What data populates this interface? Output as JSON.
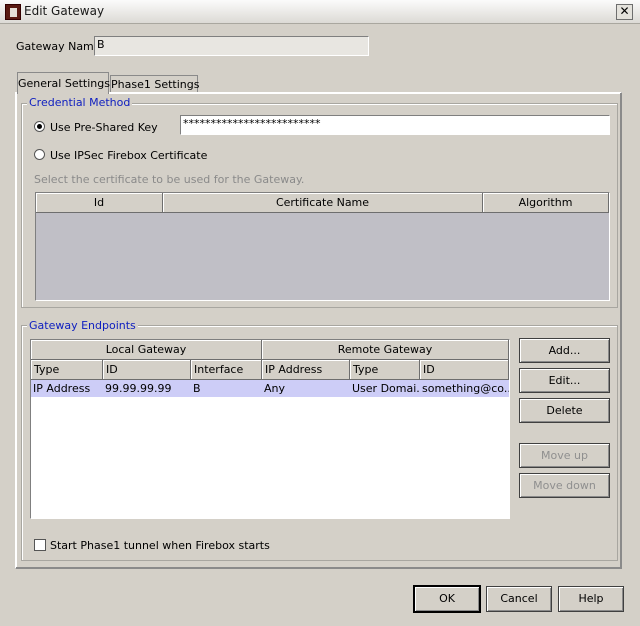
{
  "window": {
    "title": "Edit Gateway",
    "close_glyph": "✕"
  },
  "gateway_name": {
    "label": "Gateway Name:",
    "value": "B"
  },
  "tabs": [
    {
      "label": "General Settings",
      "active": true
    },
    {
      "label": "Phase1 Settings",
      "active": false
    }
  ],
  "credential": {
    "title": "Credential Method",
    "psk_label": "Use Pre-Shared Key",
    "psk_value": "*************************",
    "cert_label": "Use IPSec Firebox Certificate",
    "cert_hint": "Select the certificate to be used for the Gateway.",
    "columns": [
      "Id",
      "Certificate Name",
      "Algorithm"
    ],
    "selected": "psk"
  },
  "endpoints": {
    "title": "Gateway Endpoints",
    "group_headers": [
      "Local Gateway",
      "Remote Gateway"
    ],
    "columns": [
      "Type",
      "ID",
      "Interface",
      "IP Address",
      "Type",
      "ID"
    ],
    "rows": [
      {
        "cells": [
          "IP Address",
          "99.99.99.99",
          "B",
          "Any",
          "User Domai...",
          "something@co..."
        ],
        "selected": true
      }
    ],
    "buttons": {
      "add": "Add...",
      "edit": "Edit...",
      "delete": "Delete",
      "move_up": "Move up",
      "move_down": "Move down"
    },
    "start_phase1_label": "Start Phase1 tunnel when Firebox starts",
    "start_phase1_checked": false
  },
  "footer": {
    "ok": "OK",
    "cancel": "Cancel",
    "help": "Help"
  },
  "colors": {
    "selection": "#cdcdf7",
    "group_title": "#1020c0",
    "empty_table": "#c0bfc6"
  }
}
